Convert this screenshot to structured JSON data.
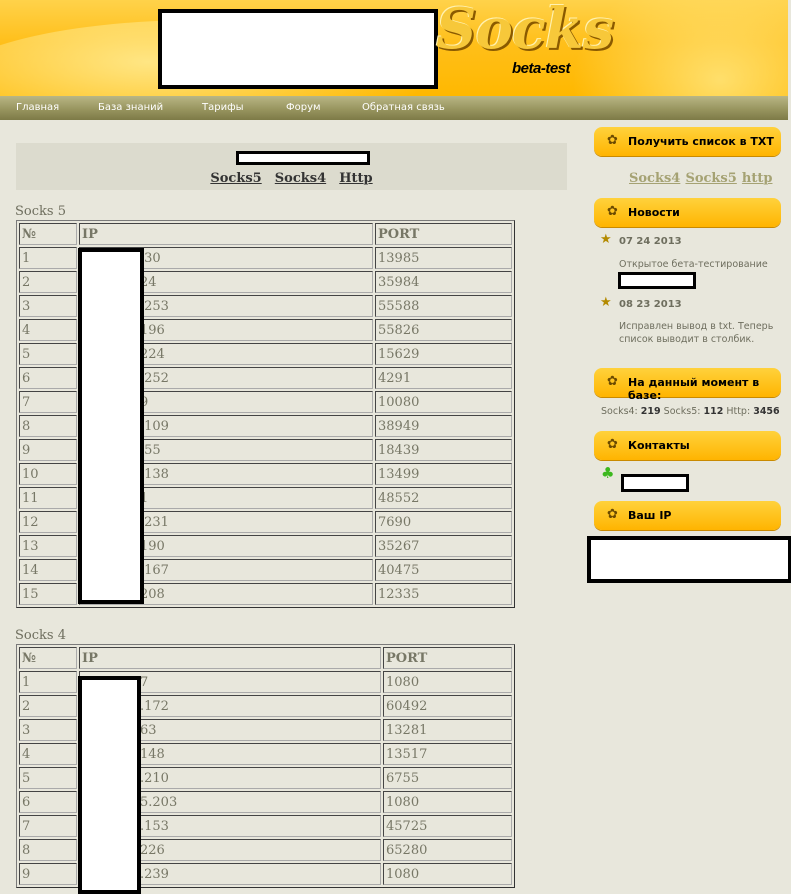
{
  "header": {
    "logo_text": "Socks",
    "logo_sub": "beta-test"
  },
  "nav": {
    "items": [
      "Главная",
      "База знаний",
      "Тарифы",
      "Форум",
      "Обратная связь"
    ]
  },
  "filter": {
    "links": [
      "Socks5",
      "Socks4",
      "Http"
    ]
  },
  "socks5": {
    "title": "Socks 5",
    "headers": [
      "№",
      "IP",
      "PORT"
    ],
    "rows": [
      [
        "1",
        ".30",
        "13985"
      ],
      [
        "2",
        "24",
        "35984"
      ],
      [
        "3",
        ".253",
        "55588"
      ],
      [
        "4",
        "196",
        "55826"
      ],
      [
        "5",
        "224",
        "15629"
      ],
      [
        "6",
        ".252",
        "4291"
      ],
      [
        "7",
        "9",
        "10080"
      ],
      [
        "8",
        ".109",
        "38949"
      ],
      [
        "9",
        ".55",
        "18439"
      ],
      [
        "10",
        ".138",
        "13499"
      ],
      [
        "11",
        "1",
        "48552"
      ],
      [
        "12",
        ".231",
        "7690"
      ],
      [
        "13",
        "190",
        "35267"
      ],
      [
        "14",
        ".167",
        "40475"
      ],
      [
        "15",
        "208",
        "12335"
      ]
    ]
  },
  "socks4": {
    "title": "Socks 4",
    "headers": [
      "№",
      "IP",
      "PORT"
    ],
    "rows": [
      [
        "1",
        "7",
        "1080"
      ],
      [
        "2",
        ".172",
        "60492"
      ],
      [
        "3",
        "63",
        "13281"
      ],
      [
        "4",
        "148",
        "13517"
      ],
      [
        "5",
        ".210",
        "6755"
      ],
      [
        "6",
        "5.203",
        "1080"
      ],
      [
        "7",
        ".153",
        "45725"
      ],
      [
        "8",
        "226",
        "65280"
      ],
      [
        "9",
        ".239",
        "1080"
      ]
    ]
  },
  "sidebar": {
    "txt": {
      "title": "Получить список в TXT",
      "links": [
        "Socks4",
        "Socks5",
        "http"
      ]
    },
    "news": {
      "title": "Новости",
      "items": [
        {
          "date": "07 24 2013",
          "text": "Открытое бета-тестирование"
        },
        {
          "date": "08 23 2013",
          "text": "Исправлен вывод в txt. Теперь список выводит в столбик."
        }
      ]
    },
    "stats": {
      "title": "На данный момент в базе:",
      "socks4_label": "Socks4:",
      "socks4": "219",
      "socks5_label": "Socks5:",
      "socks5": "112",
      "http_label": "Http:",
      "http": "3456"
    },
    "contacts": {
      "title": "Контакты"
    },
    "your_ip": {
      "title": "Ваш IP"
    }
  }
}
